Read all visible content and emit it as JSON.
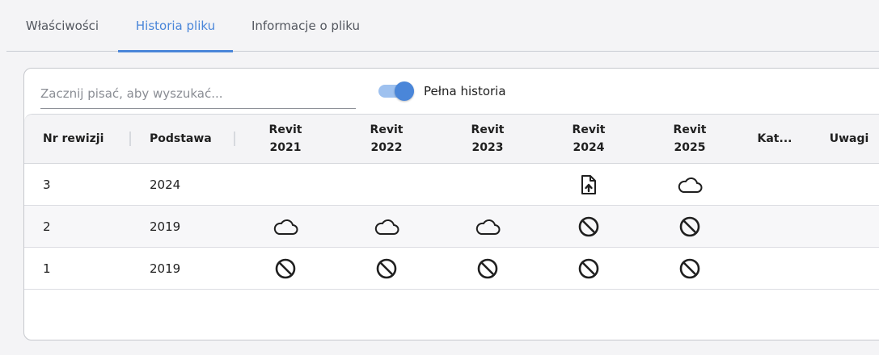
{
  "tabs": [
    {
      "label": "Właściwości",
      "active": false
    },
    {
      "label": "Historia pliku",
      "active": true
    },
    {
      "label": "Informacje o pliku",
      "active": false
    }
  ],
  "search": {
    "placeholder": "Zacznij pisać, aby wyszukać..."
  },
  "toggle": {
    "label": "Pełna historia",
    "on": true
  },
  "table": {
    "headers": {
      "rev": "Nr rewizji",
      "base": "Podstawa",
      "r2021": [
        "Revit",
        "2021"
      ],
      "r2022": [
        "Revit",
        "2022"
      ],
      "r2023": [
        "Revit",
        "2023"
      ],
      "r2024": [
        "Revit",
        "2024"
      ],
      "r2025": [
        "Revit",
        "2025"
      ],
      "kat": "Kat...",
      "notes": "Uwagi"
    },
    "rows": [
      {
        "rev": "3",
        "base": "2024",
        "r2021": "",
        "r2022": "",
        "r2023": "",
        "r2024": "file-upload-icon",
        "r2025": "cloud-icon"
      },
      {
        "rev": "2",
        "base": "2019",
        "r2021": "cloud-icon",
        "r2022": "cloud-icon",
        "r2023": "cloud-icon",
        "r2024": "blocked-icon",
        "r2025": "blocked-icon"
      },
      {
        "rev": "1",
        "base": "2019",
        "r2021": "blocked-icon",
        "r2022": "blocked-icon",
        "r2023": "blocked-icon",
        "r2024": "blocked-icon",
        "r2025": "blocked-icon"
      }
    ]
  },
  "colors": {
    "accent": "#4a86d9",
    "accent_light": "#9ec1ef"
  }
}
